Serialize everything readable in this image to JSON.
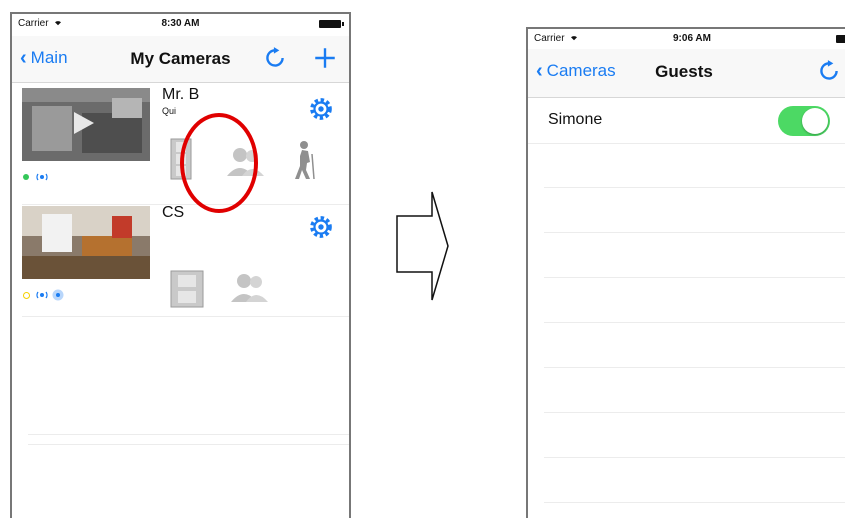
{
  "left_screen": {
    "status": {
      "carrier": "Carrier",
      "time": "8:30 AM"
    },
    "nav": {
      "back_label": "Main",
      "title": "My Cameras"
    },
    "cameras": [
      {
        "name": "Mr. B",
        "subtitle": "Qui",
        "status_dot": "#34c759"
      },
      {
        "name": "CS",
        "subtitle": "",
        "status_dot": "#f5d000"
      }
    ]
  },
  "right_screen": {
    "status": {
      "carrier": "Carrier",
      "time": "9:06 AM"
    },
    "nav": {
      "back_label": "Cameras",
      "title": "Guests"
    },
    "guests": [
      {
        "name": "Simone",
        "enabled": true
      }
    ]
  },
  "colors": {
    "accent": "#1a7cf2",
    "highlight": "#e00000",
    "toggle_on": "#4cd964"
  },
  "icons": [
    "chevron-left-icon",
    "refresh-icon",
    "plus-icon",
    "gear-icon",
    "film-strip-icon",
    "guests-icon",
    "hiker-icon",
    "arrow-right-icon",
    "wifi-icon"
  ]
}
